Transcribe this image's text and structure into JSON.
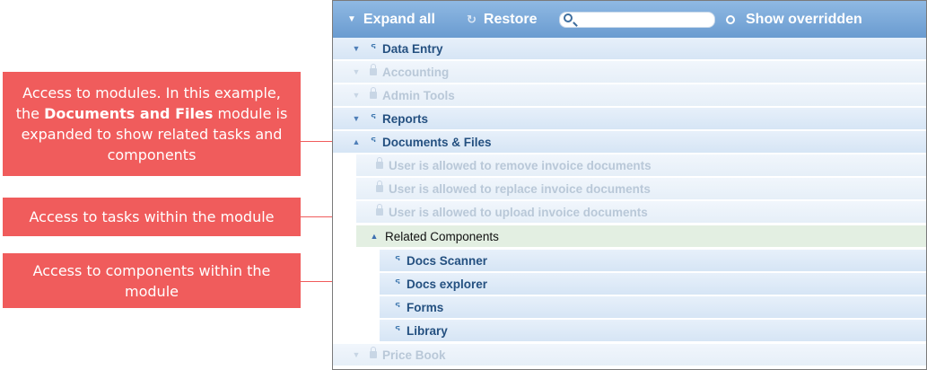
{
  "callouts": {
    "modules": {
      "part1": "Access to modules. In this example, the ",
      "bold": "Documents and Files",
      "part2": " module is expanded to show related tasks and components"
    },
    "tasks": "Access to tasks within the module",
    "components": "Access to components within the module"
  },
  "toolbar": {
    "expand_all": "Expand all",
    "restore": "Restore",
    "search_value": "",
    "show_overridden": "Show overridden"
  },
  "tree": {
    "modules": [
      {
        "label": "Data Entry",
        "state": "enabled",
        "expanded": false
      },
      {
        "label": "Accounting",
        "state": "disabled",
        "expanded": false
      },
      {
        "label": "Admin Tools",
        "state": "disabled",
        "expanded": false
      },
      {
        "label": "Reports",
        "state": "enabled",
        "expanded": false
      },
      {
        "label": "Documents & Files",
        "state": "enabled",
        "expanded": true
      }
    ],
    "tasks": [
      {
        "label": "User is allowed to remove invoice documents",
        "state": "disabled"
      },
      {
        "label": "User is allowed to replace invoice documents",
        "state": "disabled"
      },
      {
        "label": "User is allowed to upload invoice documents",
        "state": "disabled"
      }
    ],
    "related_components": {
      "label": "Related Components",
      "items": [
        {
          "label": "Docs Scanner",
          "state": "enabled"
        },
        {
          "label": "Docs explorer",
          "state": "enabled"
        },
        {
          "label": "Forms",
          "state": "enabled"
        },
        {
          "label": "Library",
          "state": "enabled"
        }
      ]
    },
    "after": [
      {
        "label": "Price Book",
        "state": "disabled",
        "expanded": false
      }
    ]
  },
  "icons": {
    "expand": "triangle-down-icon",
    "collapse": "triangle-up-icon",
    "unlocked": "unlocked-icon",
    "locked": "locked-icon",
    "restore": "restore-icon",
    "search": "search-icon",
    "radio": "radio-icon"
  },
  "colors": {
    "callout": "#f05c5c",
    "toolbar": "#7aa7d8",
    "row": "#dce8f5",
    "related_row": "#e3efe2",
    "active_text": "#245080",
    "disabled_text": "#b9c8d8"
  }
}
